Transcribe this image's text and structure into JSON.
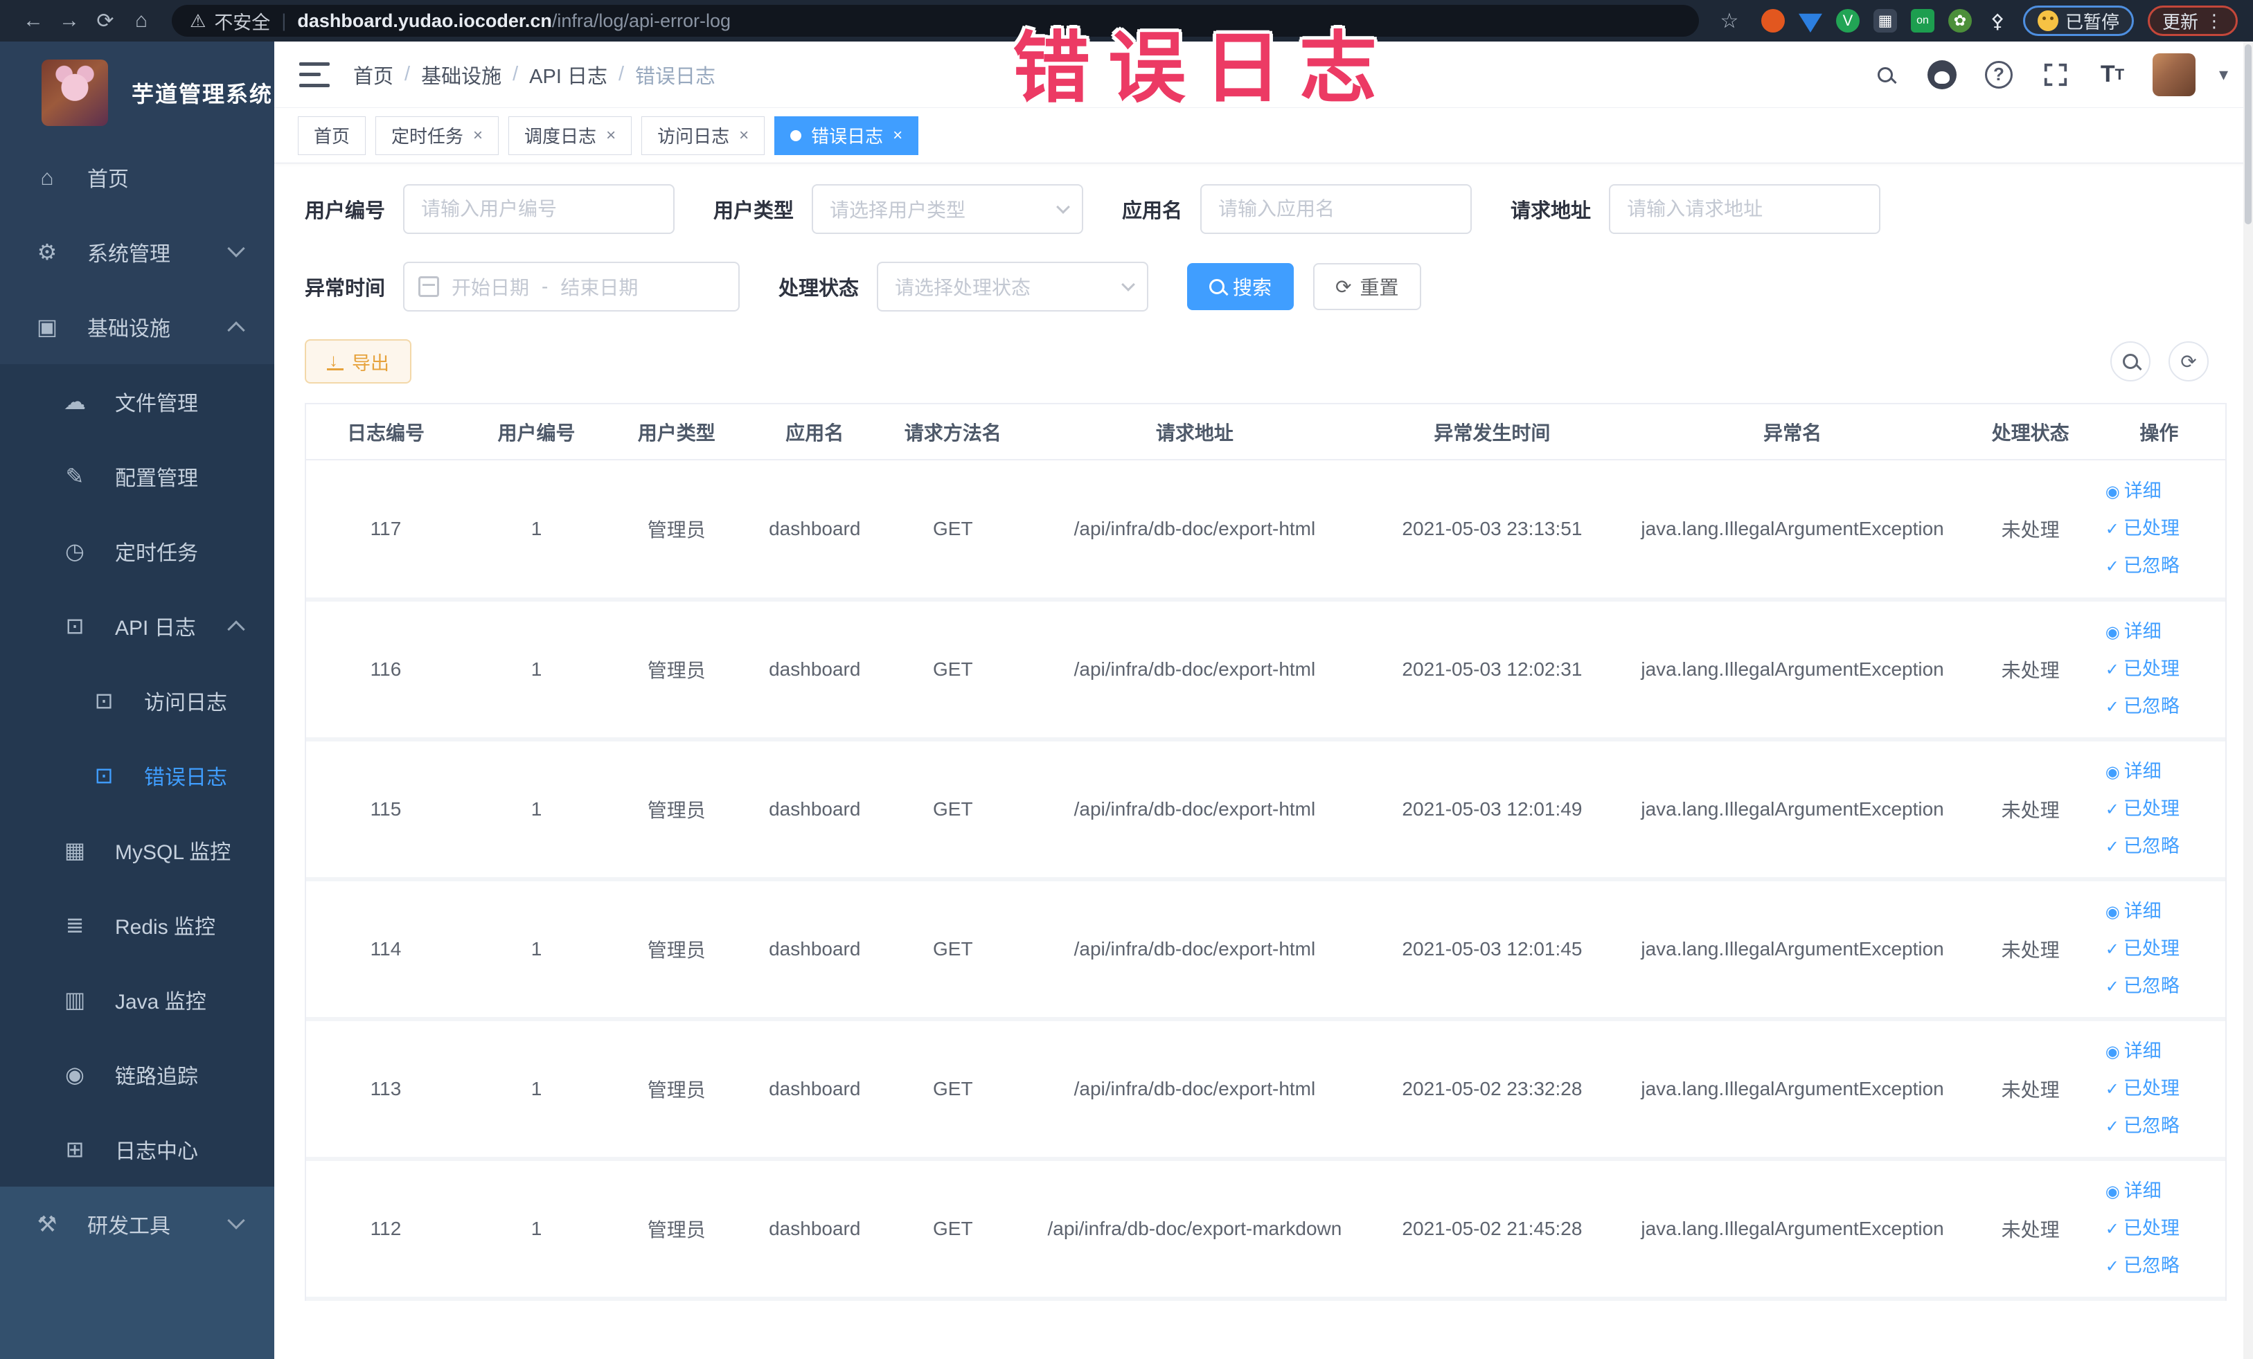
{
  "browser": {
    "security_label": "不安全",
    "url_host": "dashboard.yudao.iocoder.cn",
    "url_path": "/infra/log/api-error-log",
    "paused_badge": "已暂停",
    "update_button": "更新"
  },
  "overlay_text": "错误日志",
  "sidebar": {
    "title": "芋道管理系统",
    "items": [
      {
        "label": "首页",
        "icon": "home-icon",
        "level": 1,
        "group": "top"
      },
      {
        "label": "系统管理",
        "icon": "gear-icon",
        "level": 1,
        "chevron": "down",
        "group": "top"
      },
      {
        "label": "基础设施",
        "icon": "monitor-icon",
        "level": 1,
        "chevron": "up",
        "group": "top"
      },
      {
        "label": "文件管理",
        "icon": "cloud-upload-icon",
        "level": 2,
        "group": "sub"
      },
      {
        "label": "配置管理",
        "icon": "edit-icon",
        "level": 2,
        "group": "sub"
      },
      {
        "label": "定时任务",
        "icon": "schedule-icon",
        "level": 2,
        "group": "sub"
      },
      {
        "label": "API 日志",
        "icon": "api-log-icon",
        "level": 2,
        "chevron": "up",
        "group": "sub"
      },
      {
        "label": "访问日志",
        "icon": "access-log-icon",
        "level": 3,
        "group": "sub"
      },
      {
        "label": "错误日志",
        "icon": "error-log-icon",
        "level": 3,
        "active": true,
        "group": "sub"
      },
      {
        "label": "MySQL 监控",
        "icon": "mysql-icon",
        "level": 2,
        "group": "sub"
      },
      {
        "label": "Redis 监控",
        "icon": "redis-icon",
        "level": 2,
        "group": "sub"
      },
      {
        "label": "Java 监控",
        "icon": "java-icon",
        "level": 2,
        "group": "sub"
      },
      {
        "label": "链路追踪",
        "icon": "trace-icon",
        "level": 2,
        "group": "sub"
      },
      {
        "label": "日志中心",
        "icon": "log-center-icon",
        "level": 2,
        "group": "sub"
      },
      {
        "label": "研发工具",
        "icon": "tools-icon",
        "level": 1,
        "chevron": "down",
        "group": "bottom"
      }
    ]
  },
  "navbar": {
    "breadcrumb": [
      "首页",
      "基础设施",
      "API 日志",
      "错误日志"
    ]
  },
  "tabs": [
    {
      "label": "首页",
      "closable": false,
      "active": false
    },
    {
      "label": "定时任务",
      "closable": true,
      "active": false
    },
    {
      "label": "调度日志",
      "closable": true,
      "active": false
    },
    {
      "label": "访问日志",
      "closable": true,
      "active": false
    },
    {
      "label": "错误日志",
      "closable": true,
      "active": true
    }
  ],
  "filters": {
    "user_id": {
      "label": "用户编号",
      "placeholder": "请输入用户编号"
    },
    "user_type": {
      "label": "用户类型",
      "placeholder": "请选择用户类型"
    },
    "app_name": {
      "label": "应用名",
      "placeholder": "请输入应用名"
    },
    "request_url": {
      "label": "请求地址",
      "placeholder": "请输入请求地址"
    },
    "exception_time": {
      "label": "异常时间",
      "start_placeholder": "开始日期",
      "separator": "-",
      "end_placeholder": "结束日期"
    },
    "process_status": {
      "label": "处理状态",
      "placeholder": "请选择处理状态"
    },
    "search_button": "搜索",
    "reset_button": "重置"
  },
  "toolbar": {
    "export_button": "导出"
  },
  "table": {
    "columns": [
      "日志编号",
      "用户编号",
      "用户类型",
      "应用名",
      "请求方法名",
      "请求地址",
      "异常发生时间",
      "异常名",
      "处理状态",
      "操作"
    ],
    "actions": [
      {
        "icon": "eye-icon",
        "label": "详细"
      },
      {
        "icon": "check-icon",
        "label": "已处理"
      },
      {
        "icon": "check-icon",
        "label": "已忽略"
      }
    ],
    "rows": [
      {
        "id": "117",
        "user_id": "1",
        "user_type": "管理员",
        "app": "dashboard",
        "method": "GET",
        "url": "/api/infra/db-doc/export-html",
        "time": "2021-05-03 23:13:51",
        "exception": "java.lang.IllegalArgumentException",
        "status": "未处理"
      },
      {
        "id": "116",
        "user_id": "1",
        "user_type": "管理员",
        "app": "dashboard",
        "method": "GET",
        "url": "/api/infra/db-doc/export-html",
        "time": "2021-05-03 12:02:31",
        "exception": "java.lang.IllegalArgumentException",
        "status": "未处理"
      },
      {
        "id": "115",
        "user_id": "1",
        "user_type": "管理员",
        "app": "dashboard",
        "method": "GET",
        "url": "/api/infra/db-doc/export-html",
        "time": "2021-05-03 12:01:49",
        "exception": "java.lang.IllegalArgumentException",
        "status": "未处理"
      },
      {
        "id": "114",
        "user_id": "1",
        "user_type": "管理员",
        "app": "dashboard",
        "method": "GET",
        "url": "/api/infra/db-doc/export-html",
        "time": "2021-05-03 12:01:45",
        "exception": "java.lang.IllegalArgumentException",
        "status": "未处理"
      },
      {
        "id": "113",
        "user_id": "1",
        "user_type": "管理员",
        "app": "dashboard",
        "method": "GET",
        "url": "/api/infra/db-doc/export-html",
        "time": "2021-05-02 23:32:28",
        "exception": "java.lang.IllegalArgumentException",
        "status": "未处理"
      },
      {
        "id": "112",
        "user_id": "1",
        "user_type": "管理员",
        "app": "dashboard",
        "method": "GET",
        "url": "/api/infra/db-doc/export-markdown",
        "time": "2021-05-02 21:45:28",
        "exception": "java.lang.IllegalArgumentException",
        "status": "未处理"
      }
    ]
  },
  "colors": {
    "accent": "#409eff",
    "warning": "#e6a23c",
    "overlay_pink": "#ec3a64",
    "sidebar_bg": "#2b405a"
  }
}
